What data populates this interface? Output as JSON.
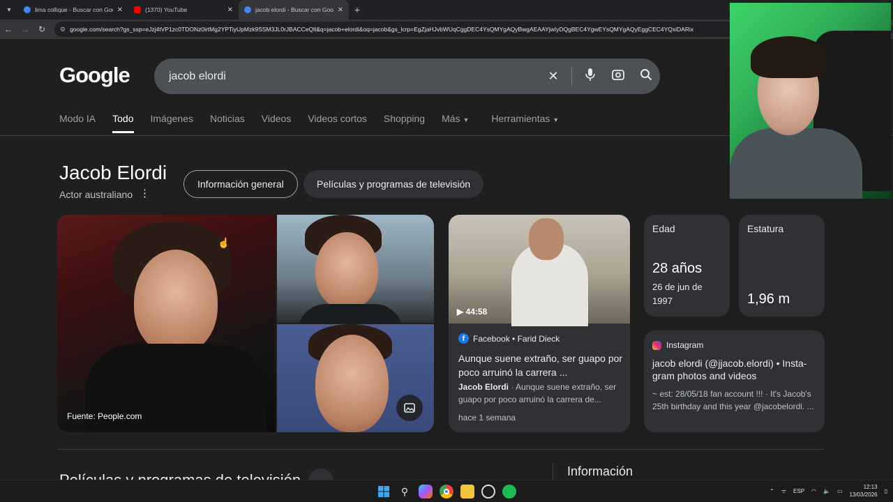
{
  "browser": {
    "tabs": [
      {
        "title": "lima collique - Buscar con Google",
        "favicon_color": "#4285f4"
      },
      {
        "title": "(1370) YouTube",
        "favicon_color": "#ff0000"
      },
      {
        "title": "jacob elordi - Buscar con Google",
        "favicon_color": "#4285f4",
        "active": true
      }
    ],
    "url": "google.com/search?gs_ssp=eJzj4tVP1zc0TDONz0irtMg2YPTiyUpMzk9SSM3JL0rJBACCeQlI&q=jacob+elordi&oq=jacob&gs_lcrp=EgZjaHJvbWUqCggDEC4YsQMYgAQyBwgAEAAYjwIyDQgBEC4YgwEYsQMYgAQyEggCEC4YQxiDARix"
  },
  "google": {
    "logo": "Google",
    "query": "jacob elordi",
    "nav_tabs": [
      "Modo IA",
      "Todo",
      "Imágenes",
      "Noticias",
      "Videos",
      "Videos cortos",
      "Shopping",
      "Más",
      "Herramientas"
    ],
    "active_tab": "Todo"
  },
  "entity": {
    "name": "Jacob Elordi",
    "subtitle": "Actor australiano",
    "chips": [
      "Información general",
      "Películas y programas de televisión"
    ],
    "photo_source": "Fuente: People.com"
  },
  "video": {
    "duration": "44:58",
    "source": "Facebook • Farid Dieck",
    "title": "Aunque suene extraño, ser guapo por poco arruinó la carrera ...",
    "snippet_author": "Jacob Elordi",
    "snippet": " · Aunque suene extraño, ser guapo por poco arruinó la carrera de...",
    "time": "hace 1 semana"
  },
  "facts": {
    "age_label": "Edad",
    "age_value": "28 años",
    "birth_date": "26 de jun de 1997",
    "height_label": "Estatura",
    "height_value": "1,96 m"
  },
  "instagram": {
    "source": "Instagram",
    "title": "jacob elordi (@jjacob.elordi) • Insta-gram photos and videos",
    "snippet": "~ est: 28/05/18 fan account !!! · It's Jacob's 25th birthday and this year @jacobelordi. ..."
  },
  "sections": {
    "films": "Películas y programas de televisión",
    "info": "Información"
  },
  "taskbar": {
    "lang": "ESP",
    "time": "12:13",
    "date": "13/03/2026"
  }
}
